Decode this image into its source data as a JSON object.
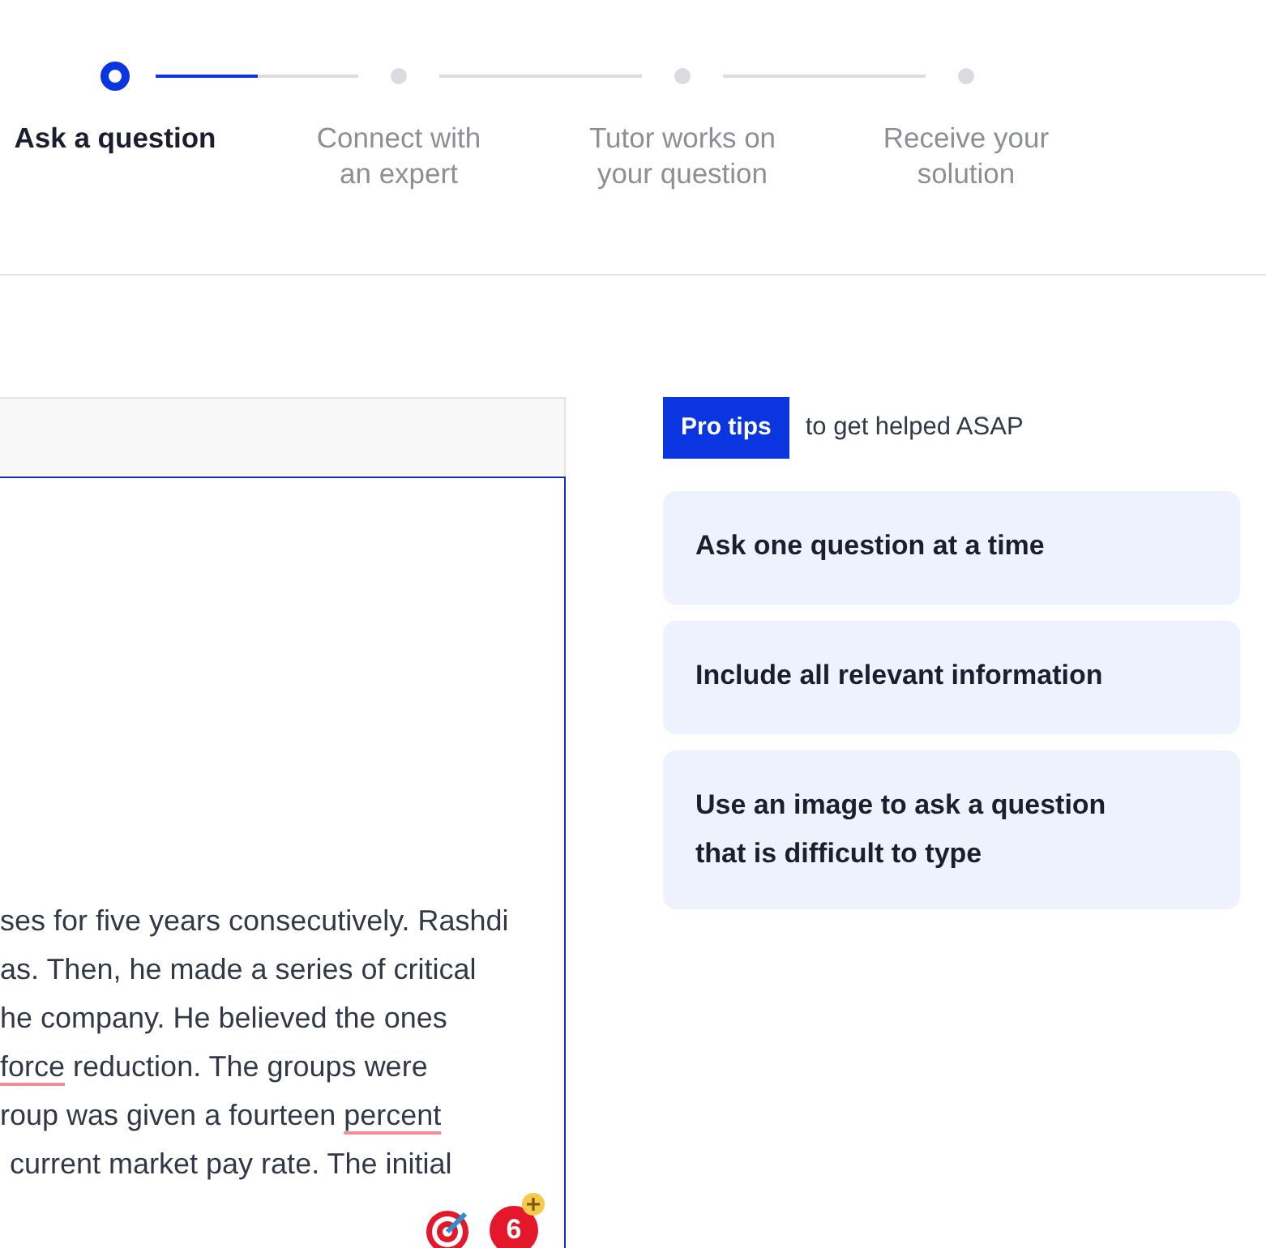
{
  "steps": [
    {
      "label": "Ask a question",
      "selected": true
    },
    {
      "label": "Connect with\nan expert",
      "selected": false
    },
    {
      "label": "Tutor works on\nyour question",
      "selected": false
    },
    {
      "label": "Receive your\nsolution",
      "selected": false
    }
  ],
  "current_step_progress": {
    "level": 0.5
  },
  "editor": {
    "lines": [
      [
        {
          "text": "ses for five years consecutively. Rashdi",
          "flagged": false
        }
      ],
      [
        {
          "text": "as. Then, he made a series of critical",
          "flagged": false
        }
      ],
      [
        {
          "text": "he company. He believed the ones",
          "flagged": false
        }
      ],
      [
        {
          "text": "force",
          "flagged": true
        },
        {
          "text": " reduction. The groups were",
          "flagged": false
        }
      ],
      [
        {
          "text": "roup was given a fourteen ",
          "flagged": false
        },
        {
          "text": "percent",
          "flagged": true
        }
      ],
      [
        {
          "text": "current market pay rate. The initial",
          "flagged": false
        }
      ]
    ],
    "badge_count": "6"
  },
  "pro_tips": {
    "badge": "Pro tips",
    "caption": "to get helped ASAP",
    "tips": [
      "Ask one question at a time",
      "Include all relevant information",
      "Use an image to ask a question\nthat is difficult to type"
    ]
  }
}
